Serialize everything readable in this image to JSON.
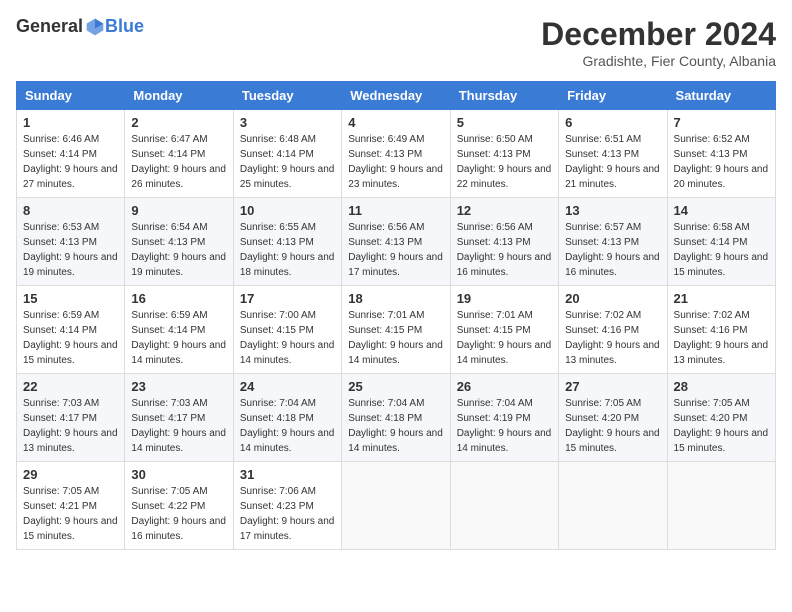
{
  "logo": {
    "general": "General",
    "blue": "Blue"
  },
  "title": "December 2024",
  "subtitle": "Gradishte, Fier County, Albania",
  "header_days": [
    "Sunday",
    "Monday",
    "Tuesday",
    "Wednesday",
    "Thursday",
    "Friday",
    "Saturday"
  ],
  "weeks": [
    [
      {
        "day": "1",
        "sunrise": "6:46 AM",
        "sunset": "4:14 PM",
        "daylight": "9 hours and 27 minutes."
      },
      {
        "day": "2",
        "sunrise": "6:47 AM",
        "sunset": "4:14 PM",
        "daylight": "9 hours and 26 minutes."
      },
      {
        "day": "3",
        "sunrise": "6:48 AM",
        "sunset": "4:14 PM",
        "daylight": "9 hours and 25 minutes."
      },
      {
        "day": "4",
        "sunrise": "6:49 AM",
        "sunset": "4:13 PM",
        "daylight": "9 hours and 23 minutes."
      },
      {
        "day": "5",
        "sunrise": "6:50 AM",
        "sunset": "4:13 PM",
        "daylight": "9 hours and 22 minutes."
      },
      {
        "day": "6",
        "sunrise": "6:51 AM",
        "sunset": "4:13 PM",
        "daylight": "9 hours and 21 minutes."
      },
      {
        "day": "7",
        "sunrise": "6:52 AM",
        "sunset": "4:13 PM",
        "daylight": "9 hours and 20 minutes."
      }
    ],
    [
      {
        "day": "8",
        "sunrise": "6:53 AM",
        "sunset": "4:13 PM",
        "daylight": "9 hours and 19 minutes."
      },
      {
        "day": "9",
        "sunrise": "6:54 AM",
        "sunset": "4:13 PM",
        "daylight": "9 hours and 19 minutes."
      },
      {
        "day": "10",
        "sunrise": "6:55 AM",
        "sunset": "4:13 PM",
        "daylight": "9 hours and 18 minutes."
      },
      {
        "day": "11",
        "sunrise": "6:56 AM",
        "sunset": "4:13 PM",
        "daylight": "9 hours and 17 minutes."
      },
      {
        "day": "12",
        "sunrise": "6:56 AM",
        "sunset": "4:13 PM",
        "daylight": "9 hours and 16 minutes."
      },
      {
        "day": "13",
        "sunrise": "6:57 AM",
        "sunset": "4:13 PM",
        "daylight": "9 hours and 16 minutes."
      },
      {
        "day": "14",
        "sunrise": "6:58 AM",
        "sunset": "4:14 PM",
        "daylight": "9 hours and 15 minutes."
      }
    ],
    [
      {
        "day": "15",
        "sunrise": "6:59 AM",
        "sunset": "4:14 PM",
        "daylight": "9 hours and 15 minutes."
      },
      {
        "day": "16",
        "sunrise": "6:59 AM",
        "sunset": "4:14 PM",
        "daylight": "9 hours and 14 minutes."
      },
      {
        "day": "17",
        "sunrise": "7:00 AM",
        "sunset": "4:15 PM",
        "daylight": "9 hours and 14 minutes."
      },
      {
        "day": "18",
        "sunrise": "7:01 AM",
        "sunset": "4:15 PM",
        "daylight": "9 hours and 14 minutes."
      },
      {
        "day": "19",
        "sunrise": "7:01 AM",
        "sunset": "4:15 PM",
        "daylight": "9 hours and 14 minutes."
      },
      {
        "day": "20",
        "sunrise": "7:02 AM",
        "sunset": "4:16 PM",
        "daylight": "9 hours and 13 minutes."
      },
      {
        "day": "21",
        "sunrise": "7:02 AM",
        "sunset": "4:16 PM",
        "daylight": "9 hours and 13 minutes."
      }
    ],
    [
      {
        "day": "22",
        "sunrise": "7:03 AM",
        "sunset": "4:17 PM",
        "daylight": "9 hours and 13 minutes."
      },
      {
        "day": "23",
        "sunrise": "7:03 AM",
        "sunset": "4:17 PM",
        "daylight": "9 hours and 14 minutes."
      },
      {
        "day": "24",
        "sunrise": "7:04 AM",
        "sunset": "4:18 PM",
        "daylight": "9 hours and 14 minutes."
      },
      {
        "day": "25",
        "sunrise": "7:04 AM",
        "sunset": "4:18 PM",
        "daylight": "9 hours and 14 minutes."
      },
      {
        "day": "26",
        "sunrise": "7:04 AM",
        "sunset": "4:19 PM",
        "daylight": "9 hours and 14 minutes."
      },
      {
        "day": "27",
        "sunrise": "7:05 AM",
        "sunset": "4:20 PM",
        "daylight": "9 hours and 15 minutes."
      },
      {
        "day": "28",
        "sunrise": "7:05 AM",
        "sunset": "4:20 PM",
        "daylight": "9 hours and 15 minutes."
      }
    ],
    [
      {
        "day": "29",
        "sunrise": "7:05 AM",
        "sunset": "4:21 PM",
        "daylight": "9 hours and 15 minutes."
      },
      {
        "day": "30",
        "sunrise": "7:05 AM",
        "sunset": "4:22 PM",
        "daylight": "9 hours and 16 minutes."
      },
      {
        "day": "31",
        "sunrise": "7:06 AM",
        "sunset": "4:23 PM",
        "daylight": "9 hours and 17 minutes."
      },
      null,
      null,
      null,
      null
    ]
  ]
}
